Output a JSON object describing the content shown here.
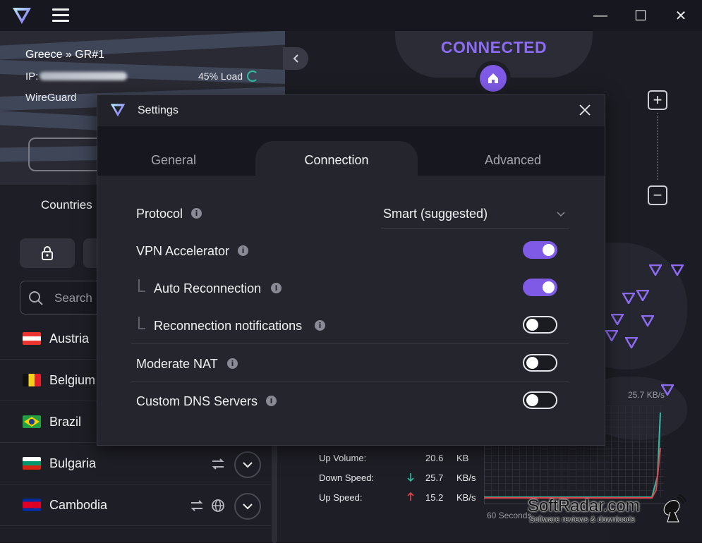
{
  "titlebar": {
    "minimize": "—",
    "maximize": "☐",
    "close": "✕"
  },
  "connection": {
    "server": "Greece » GR#1",
    "ip_label": "IP:",
    "load": "45% Load",
    "protocol": "WireGuard",
    "status": "CONNECTED"
  },
  "sidebar": {
    "tab_countries": "Countries",
    "search_placeholder": "Search",
    "countries": [
      {
        "name": "Austria"
      },
      {
        "name": "Belgium"
      },
      {
        "name": "Brazil"
      },
      {
        "name": "Bulgaria"
      },
      {
        "name": "Cambodia"
      }
    ]
  },
  "map": {
    "zoom_in": "+",
    "zoom_out": "−"
  },
  "stats": {
    "up_volume_label": "Up Volume:",
    "up_volume_value": "20.6",
    "up_volume_unit": "KB",
    "down_speed_label": "Down Speed:",
    "down_speed_value": "25.7",
    "down_speed_unit": "KB/s",
    "up_speed_label": "Up Speed:",
    "up_speed_value": "15.2",
    "up_speed_unit": "KB/s",
    "graph_max": "25.7  KB/s",
    "graph_window": "60 Seconds",
    "down_color": "#2fbf9f",
    "up_color": "#e0454f"
  },
  "settings": {
    "title": "Settings",
    "tabs": [
      "General",
      "Connection",
      "Advanced"
    ],
    "active_tab": "Connection",
    "protocol_label": "Protocol",
    "protocol_value": "Smart (suggested)",
    "items": [
      {
        "label": "VPN Accelerator",
        "enabled": true
      },
      {
        "label": "Auto Reconnection",
        "enabled": true
      },
      {
        "label": "Reconnection notifications",
        "enabled": false
      },
      {
        "label": "Moderate NAT",
        "enabled": false
      },
      {
        "label": "Custom DNS Servers",
        "enabled": false
      }
    ],
    "accent": "#7f5ae6"
  },
  "watermark": {
    "title": "SoftRadar.com",
    "subtitle": "Software reviews & downloads"
  }
}
